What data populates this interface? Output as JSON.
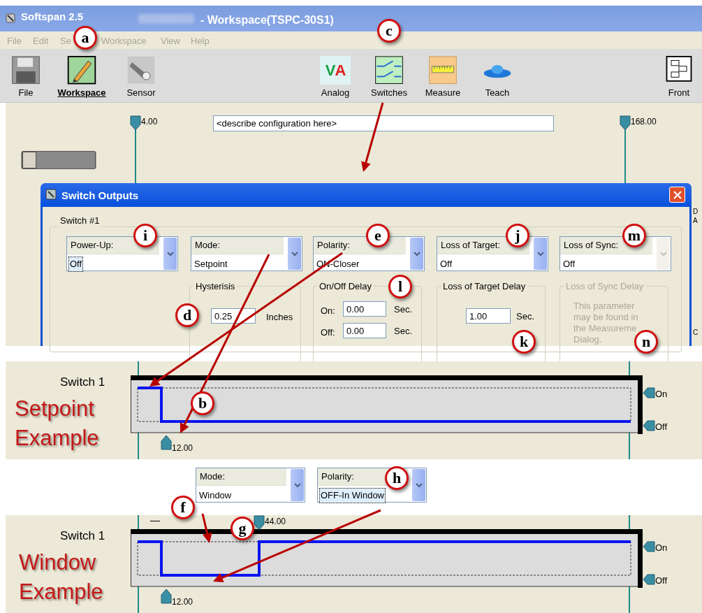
{
  "title_bar": {
    "app": "Softspan 2.5",
    "document": "- Workspace(TSPC-30S1)"
  },
  "menu": [
    "File",
    "Edit",
    "Se",
    "Workspace",
    "View",
    "Help"
  ],
  "toolbar": [
    {
      "label": "File",
      "kind": "floppy",
      "selected": false
    },
    {
      "label": "Workspace",
      "kind": "pencil",
      "selected": true
    },
    {
      "label": "Sensor",
      "kind": "sensor",
      "selected": false
    },
    {
      "label": "Analog",
      "kind": "analog",
      "glyph": "VA",
      "selected": false
    },
    {
      "label": "Switches",
      "kind": "switches",
      "selected": false
    },
    {
      "label": "Measure",
      "kind": "ruler",
      "selected": false
    },
    {
      "label": "Teach",
      "kind": "disc",
      "selected": false
    },
    {
      "label": "Front",
      "kind": "front",
      "selected": false
    }
  ],
  "workspace": {
    "start_marker": "4.00",
    "end_marker": "168.00",
    "description": "<describe configuration here>",
    "edge_labels": [
      "D",
      "A",
      "C"
    ]
  },
  "dialog": {
    "title": "Switch Outputs",
    "group": "Switch #1",
    "dropdowns": [
      {
        "label": "Power-Up:",
        "value": "Off",
        "focused": true,
        "disabled": false
      },
      {
        "label": "Mode:",
        "value": "Setpoint",
        "focused": false,
        "disabled": false
      },
      {
        "label": "Polarity:",
        "value": "ON-Closer",
        "focused": false,
        "disabled": false
      },
      {
        "label": "Loss of Target:",
        "value": "Off",
        "focused": false,
        "disabled": false
      },
      {
        "label": "Loss of Sync:",
        "value": "Off",
        "focused": false,
        "disabled": true
      }
    ],
    "hysteresis": {
      "title": "Hysterisis",
      "value": "0.25",
      "unit": "Inches"
    },
    "delay": {
      "title": "On/Off Delay",
      "rows": [
        {
          "label": "On:",
          "value": "0.00",
          "unit": "Sec."
        },
        {
          "label": "Off:",
          "value": "0.00",
          "unit": "Sec."
        }
      ]
    },
    "target_delay": {
      "title": "Loss of Target Delay",
      "value": "1.00",
      "unit": "Sec."
    },
    "sync_delay": {
      "title": "Loss of Sync Delay",
      "disabled": true,
      "note": "This parameter may be found in the Measureme Dialog."
    }
  },
  "examples": [
    {
      "switch_label": "Switch 1",
      "caption": [
        "Setpoint",
        "Example"
      ],
      "on": "On",
      "off": "Off",
      "markers": [
        "12.00"
      ]
    },
    {
      "switch_label": "Switch 1",
      "caption": [
        "Window",
        "Example"
      ],
      "on": "On",
      "off": "Off",
      "markers": [
        "12.00",
        "44.00"
      ]
    }
  ],
  "window_dropdowns": [
    {
      "label": "Mode:",
      "value": "Window",
      "focused": false
    },
    {
      "label": "Polarity:",
      "value": "OFF-In Window",
      "focused": true
    }
  ],
  "callouts": [
    "a",
    "c",
    "i",
    "e",
    "j",
    "m",
    "d",
    "l",
    "k",
    "n",
    "b",
    "h",
    "f",
    "g"
  ]
}
